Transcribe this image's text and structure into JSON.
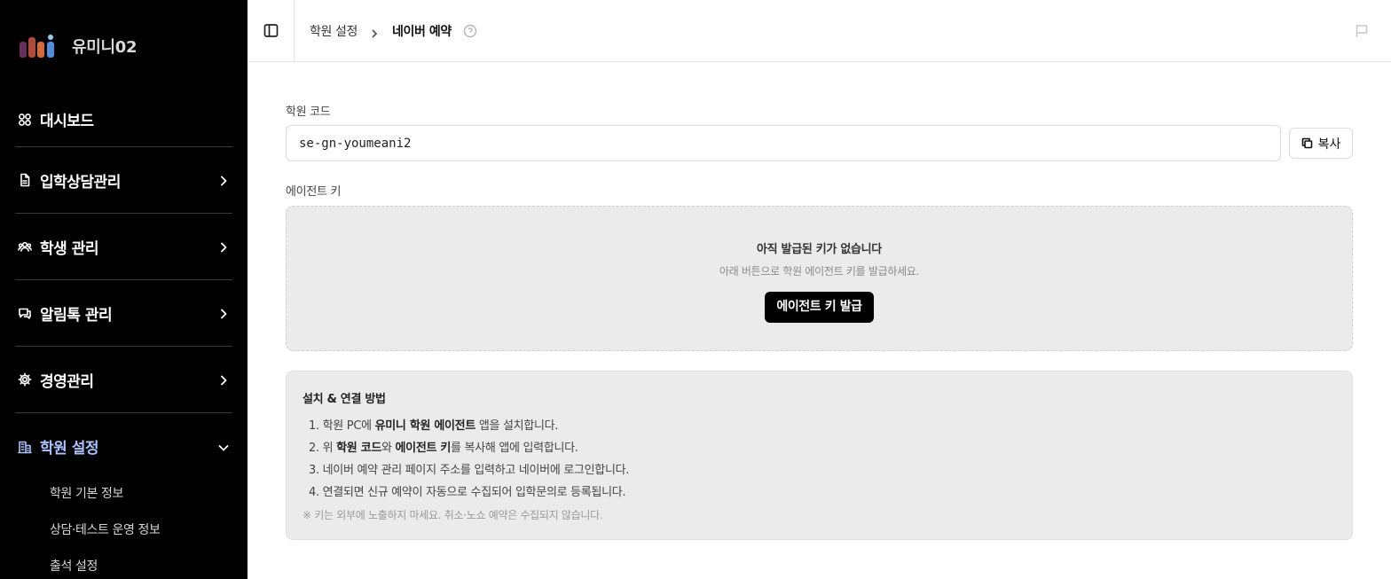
{
  "brand": {
    "name": "유미니02"
  },
  "sidebar": {
    "items": [
      {
        "label": "대시보드",
        "icon": "grid-icon"
      },
      {
        "label": "입학상담관리",
        "icon": "document-icon"
      },
      {
        "label": "학생 관리",
        "icon": "users-icon"
      },
      {
        "label": "알림톡 관리",
        "icon": "chat-icon"
      },
      {
        "label": "경영관리",
        "icon": "gear-icon"
      },
      {
        "label": "학원 설정",
        "icon": "building-icon"
      }
    ],
    "sub_items": [
      "학원 기본 정보",
      "상담·테스트 운영 정보",
      "출석 설정"
    ]
  },
  "header": {
    "breadcrumb": [
      "학원 설정",
      "네이버 예약"
    ]
  },
  "academy_code": {
    "label": "학원 코드",
    "value": "se-gn-youmeani2",
    "copy_label": "복사"
  },
  "agent_key": {
    "label": "에이전트 키",
    "empty_title": "아직 발급된 키가 없습니다",
    "empty_sub": "아래 버튼으로 학원 에이전트 키를 발급하세요.",
    "issue_label": "에이전트 키 발급"
  },
  "guide": {
    "title": "설치 & 연결 방법",
    "step1": {
      "pre": "1. 학원 PC에 ",
      "bold": "유미니 학원 에이전트",
      "post": " 앱을 설치합니다."
    },
    "step2": {
      "pre": "2. 위 ",
      "bold1": "학원 코드",
      "mid": "와 ",
      "bold2": "에이전트 키",
      "post": "를 복사해 앱에 입력합니다."
    },
    "step3": "3. 네이버 예약 관리 페이지 주소를 입력하고 네이버에 로그인합니다.",
    "step4": "4. 연결되면 신규 예약이 자동으로 수집되어 입학문의로 등록됩니다.",
    "note": "※ 키는 외부에 노출하지 마세요. 취소·노쇼 예약은 수집되지 않습니다."
  },
  "colors": {
    "sidebar_bg": "#000000",
    "active": "#a9c3ff",
    "box_bg": "#ebebeb"
  }
}
